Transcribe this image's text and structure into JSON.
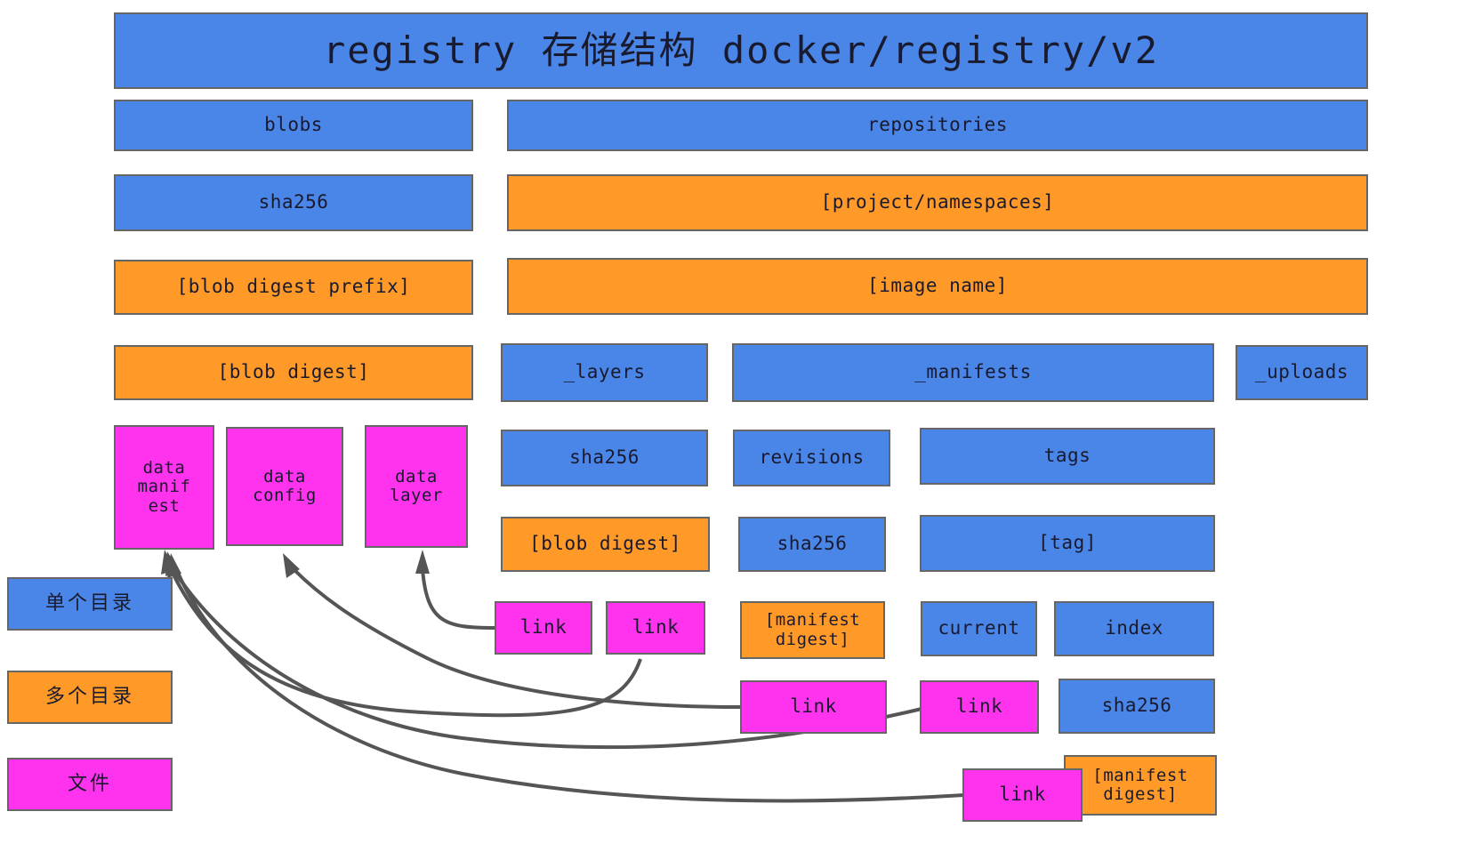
{
  "diagram": {
    "title": "registry 存储结构 docker/registry/v2",
    "colors": {
      "blue": "#4a86e8",
      "orange": "#ff9a28",
      "pink": "#ff33ee",
      "border": "#666666",
      "edge": "#555555",
      "background": "#ffffff"
    },
    "nodes": {
      "title": "registry 存储结构 docker/registry/v2",
      "blobs": "blobs",
      "repositories": "repositories",
      "blobs_sha256": "sha256",
      "project_namespaces": "[project/namespaces]",
      "blob_digest_prefix": "[blob digest prefix]",
      "image_name": "[image name]",
      "blob_digest": "[blob digest]",
      "layers": "_layers",
      "manifests": "_manifests",
      "uploads": "_uploads",
      "data_manifest": "data\nmanif\nest",
      "data_config": "data\nconfig",
      "data_layer": "data\nlayer",
      "layers_sha256": "sha256",
      "revisions": "revisions",
      "tags": "tags",
      "layers_blob_digest": "[blob digest]",
      "revisions_sha256": "sha256",
      "tag": "[tag]",
      "link_layers_1": "link",
      "link_layers_2": "link",
      "revisions_manifest_digest": "[manifest\ndigest]",
      "current": "current",
      "index": "index",
      "link_revisions": "link",
      "link_current": "link",
      "index_sha256": "sha256",
      "link_index": "link",
      "index_manifest_digest": "[manifest\ndigest]"
    },
    "legend": [
      {
        "key": "single-directory",
        "label": "单个目录",
        "color": "blue"
      },
      {
        "key": "multiple-directories",
        "label": "多个目录",
        "color": "orange"
      },
      {
        "key": "file",
        "label": "文件",
        "color": "pink"
      }
    ],
    "edges": [
      {
        "from": "link_layers_1",
        "to": "data_layer"
      },
      {
        "from": "link_layers_2",
        "to": "data_manifest"
      },
      {
        "from": "link_revisions",
        "to": "data_config"
      },
      {
        "from": "link_current",
        "to": "data_manifest"
      },
      {
        "from": "link_index",
        "to": "data_manifest"
      }
    ]
  }
}
